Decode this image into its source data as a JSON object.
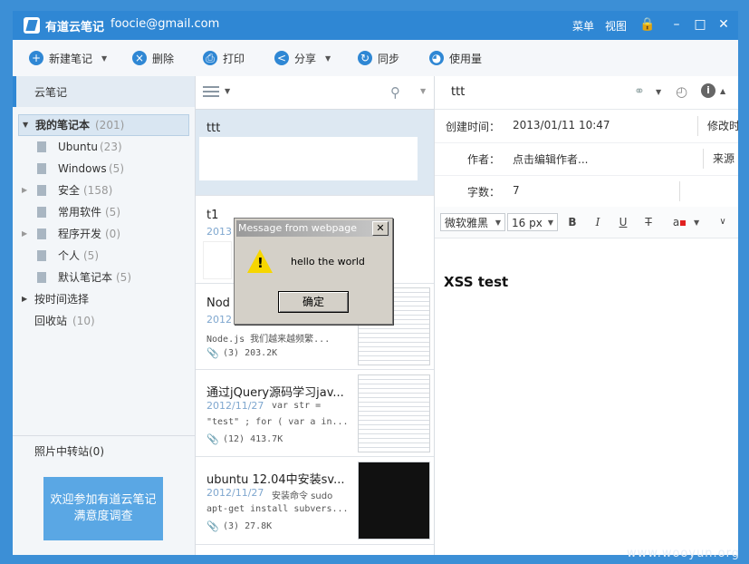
{
  "titlebar": {
    "app_name": "有道云笔记",
    "email": "foocie@gmail.com",
    "menu": "菜单",
    "view": "视图"
  },
  "toolbar": {
    "new_note": "新建笔记",
    "delete": "删除",
    "print": "打印",
    "share": "分享",
    "sync": "同步",
    "usage": "使用量"
  },
  "sidebar": {
    "header": "云笔记",
    "items": [
      {
        "label": "我的笔记本",
        "count": "(201)"
      },
      {
        "label": "Ubuntu",
        "count": "(23)"
      },
      {
        "label": "Windows",
        "count": "(5)"
      },
      {
        "label": "安全",
        "count": "(158)"
      },
      {
        "label": "常用软件",
        "count": "(5)"
      },
      {
        "label": "程序开发",
        "count": "(0)"
      },
      {
        "label": "个人",
        "count": "(5)"
      },
      {
        "label": "默认笔记本",
        "count": "(5)"
      },
      {
        "label": "按时间选择",
        "count": ""
      },
      {
        "label": "回收站",
        "count": "(10)"
      }
    ],
    "photo_station": "照片中转站(0)",
    "banner_line1": "欢迎参加有道云笔记",
    "banner_line2": "满意度调查"
  },
  "notes": [
    {
      "title": "ttt"
    },
    {
      "title": "t1",
      "date": "2013"
    },
    {
      "title": "Nod",
      "date": "2012",
      "snippet": "Node.js 我们越来越频繁...",
      "attach": "(3) 203.2K"
    },
    {
      "title": "通过jQuery源码学习jav...",
      "date": "2012/11/27",
      "snippet1": "var str =",
      "snippet2": "\"test\" ; for ( var a in...",
      "attach": "(12) 413.7K"
    },
    {
      "title": "ubuntu 12.04中安装sv...",
      "date": "2012/11/27",
      "snippet1": "安装命令 sudo",
      "snippet2": "apt-get install subvers...",
      "attach": "(3) 27.8K"
    }
  ],
  "editor": {
    "title": "ttt",
    "created_label": "创建时间：",
    "created_value": "2013/01/11 10:47",
    "modified_label": "修改时间",
    "author_label": "作者：",
    "author_value": "点击编辑作者...",
    "source_label": "来源",
    "words_label": "字数：",
    "words_value": "7",
    "font": "微软雅黑",
    "size": "16 px",
    "body": "XSS test"
  },
  "dialog": {
    "title": "Message from webpage",
    "message": "hello the world",
    "ok": "确定"
  },
  "watermark": "www.wooyun.org"
}
